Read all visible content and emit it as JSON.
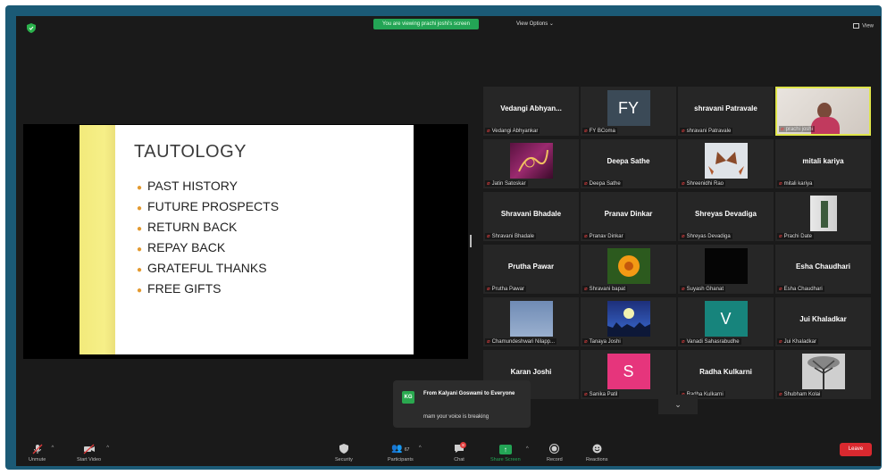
{
  "meeting": {
    "viewing_banner": "You are viewing prachi joshi's screen",
    "view_options": "View Options ⌄",
    "view_label": "View"
  },
  "slide": {
    "title": "TAUTOLOGY",
    "bullets": [
      "PAST HISTORY",
      "FUTURE PROSPECTS",
      "RETURN BACK",
      "REPAY BACK",
      "GRATEFUL THANKS",
      "FREE GIFTS"
    ]
  },
  "gallery": [
    {
      "big": "Vedangi Abhyan...",
      "label": "Vedangi Abhyankar"
    },
    {
      "avatar": "FY",
      "label": "FY BComa"
    },
    {
      "big": "shravani Patravale",
      "label": "shravani Patravale"
    },
    {
      "video": "prachi",
      "label": "prachi joshi"
    },
    {
      "video": "art",
      "label": "Jatin Satoskar"
    },
    {
      "big": "Deepa Sathe",
      "label": "Deepa Sathe"
    },
    {
      "video": "butterfly",
      "label": "Shreenidhi Rao"
    },
    {
      "big": "mitali kariya",
      "label": "mitali kariya"
    },
    {
      "big": "Shravani Bhadale",
      "label": "Shravani Bhadale"
    },
    {
      "big": "Pranav Dinkar",
      "label": "Pranav Dinkar"
    },
    {
      "big": "Shreyas Devadiga",
      "label": "Shreyas Devadiga"
    },
    {
      "video": "door",
      "label": "Prachi Date"
    },
    {
      "big": "Prutha Pawar",
      "label": "Prutha Pawar"
    },
    {
      "video": "flower",
      "label": "Shravani bapat"
    },
    {
      "video": "dark",
      "label": "Suyash Ghanat"
    },
    {
      "big": "Esha Chaudhari",
      "label": "Esha Chaudhari"
    },
    {
      "video": "sky",
      "label": "Chamundeshwari Nilapp..."
    },
    {
      "video": "night",
      "label": "Tanaya Joshi"
    },
    {
      "avatar": "V",
      "label": "Vanadi Sahasrabudhe"
    },
    {
      "big": "Jui Khaladkar",
      "label": "Jui Khaladkar"
    },
    {
      "big": "Karan Joshi",
      "label": "Karan Joshi"
    },
    {
      "avatar": "S",
      "label": "Sanika Patil"
    },
    {
      "big": "Radha Kulkarni",
      "label": "Radha Kulkarni"
    },
    {
      "video": "tree",
      "label": "Shubham Kolai"
    }
  ],
  "chat": {
    "initials": "KG",
    "from": "From Kalyani Goswami to Everyone",
    "message": "mam your voice is breaking"
  },
  "toolbar": {
    "unmute": "Unmute",
    "start_video": "Start Video",
    "security": "Security",
    "participants": "Participants",
    "participants_count": "67",
    "chat": "Chat",
    "chat_badge": "8",
    "share_screen": "Share Screen",
    "record": "Record",
    "reactions": "Reactions",
    "leave": "Leave"
  }
}
